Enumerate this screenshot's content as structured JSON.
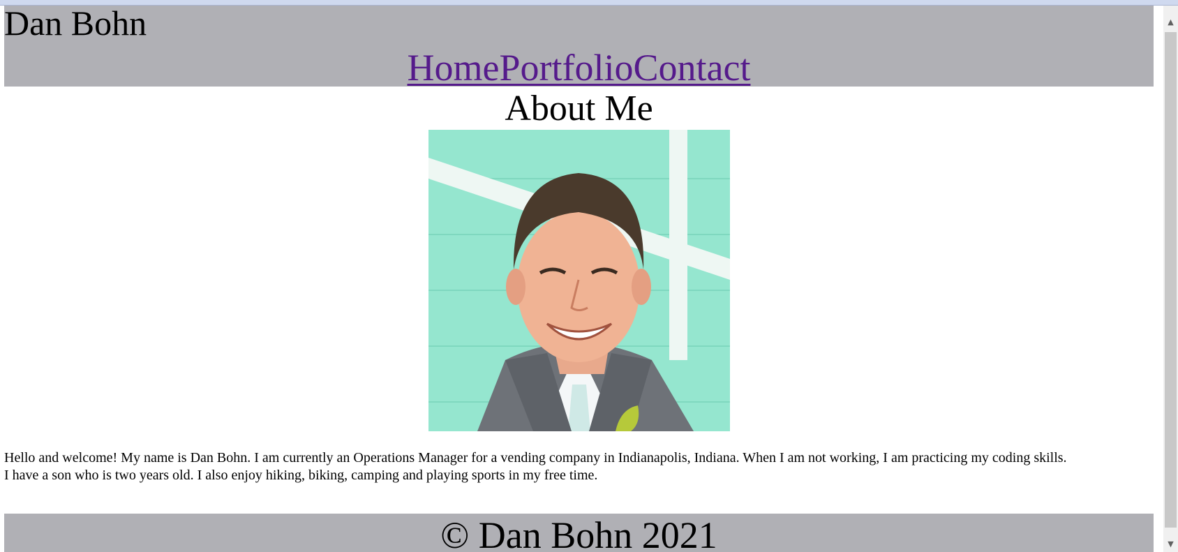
{
  "header": {
    "site_name": "Dan Bohn",
    "nav": [
      {
        "label": "Home"
      },
      {
        "label": "Portfolio"
      },
      {
        "label": "Contact"
      }
    ]
  },
  "main": {
    "title": "About Me",
    "bio_line_1": "Hello and welcome! My name is Dan Bohn. I am currently an Operations Manager for a vending company in Indianapolis, Indiana. When I am not working, I am practicing my coding skills.",
    "bio_line_2": "I have a son who is two years old. I also enjoy hiking, biking, camping and playing sports in my free time."
  },
  "footer": {
    "text": "© Dan Bohn 2021"
  },
  "colors": {
    "header_bg": "#b0b0b5",
    "link": "#551a8b",
    "photo_bg": "#95e6cf"
  }
}
